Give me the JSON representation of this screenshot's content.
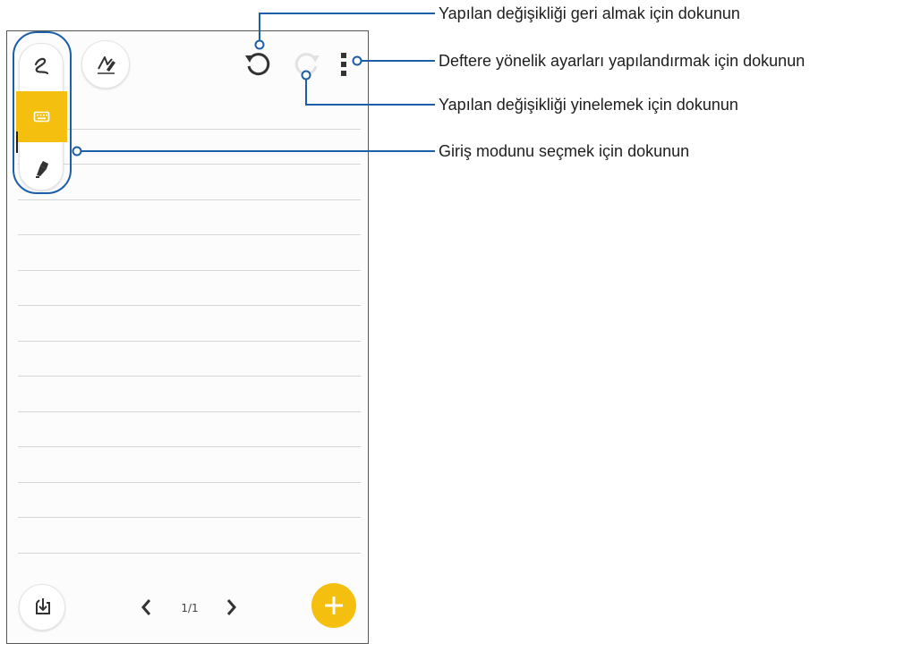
{
  "app": {
    "pagination": {
      "current": "1/1"
    }
  },
  "callouts": {
    "undo": "Yapılan değişikliği geri almak için dokunun",
    "settings": "Deftere yönelik ayarları yapılandırmak için dokunun",
    "redo": "Yapılan değişikliği yinelemek için dokunun",
    "input_mode": "Giriş modunu seçmek için dokunun"
  },
  "colors": {
    "accent": "#f5bf0f",
    "callout_line": "#1c5ea8",
    "frame": "#555555"
  },
  "icons": {
    "handwriting": "handwriting-icon",
    "keyboard": "keyboard-icon",
    "highlighter": "highlighter-icon",
    "signature": "signature-icon",
    "undo": "undo-icon",
    "redo": "redo-icon",
    "more": "more-vertical-icon",
    "import": "import-icon",
    "prev": "chevron-left-icon",
    "next": "chevron-right-icon",
    "add": "add-icon"
  }
}
